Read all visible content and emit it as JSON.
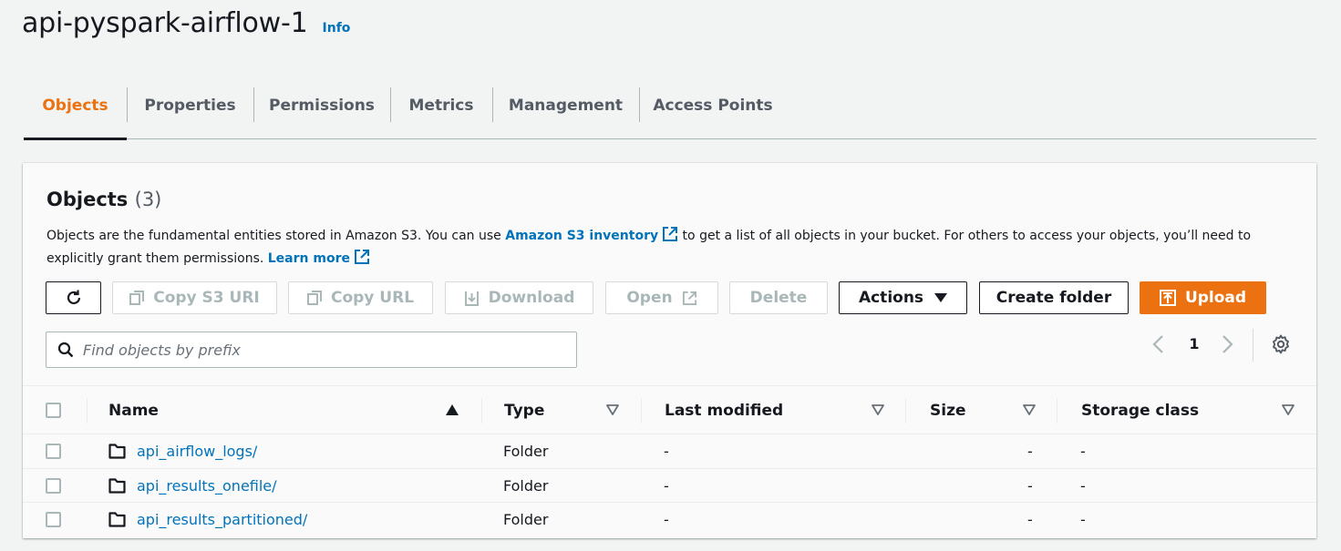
{
  "header": {
    "title": "api-pyspark-airflow-1",
    "info": "Info"
  },
  "tabs": [
    {
      "label": "Objects",
      "active": true
    },
    {
      "label": "Properties",
      "active": false
    },
    {
      "label": "Permissions",
      "active": false
    },
    {
      "label": "Metrics",
      "active": false
    },
    {
      "label": "Management",
      "active": false
    },
    {
      "label": "Access Points",
      "active": false
    }
  ],
  "panel": {
    "title": "Objects",
    "count": "(3)",
    "desc_pre": "Objects are the fundamental entities stored in Amazon S3. You can use ",
    "desc_link": "Amazon S3 inventory",
    "desc_mid": " to get a list of all objects in your bucket. For others to access your objects, you’ll need to explicitly grant them permissions. ",
    "learn_more": "Learn more"
  },
  "toolbar": {
    "copy_uri": "Copy S3 URI",
    "copy_url": "Copy URL",
    "download": "Download",
    "open": "Open",
    "delete": "Delete",
    "actions": "Actions",
    "create_folder": "Create folder",
    "upload": "Upload"
  },
  "search": {
    "placeholder": "Find objects by prefix"
  },
  "pagination": {
    "page": "1"
  },
  "table": {
    "columns": {
      "name": "Name",
      "type": "Type",
      "last_modified": "Last modified",
      "size": "Size",
      "storage_class": "Storage class"
    },
    "rows": [
      {
        "name": "api_airflow_logs/",
        "type": "Folder",
        "last_modified": "-",
        "size": "-",
        "storage_class": "-"
      },
      {
        "name": "api_results_onefile/",
        "type": "Folder",
        "last_modified": "-",
        "size": "-",
        "storage_class": "-"
      },
      {
        "name": "api_results_partitioned/",
        "type": "Folder",
        "last_modified": "-",
        "size": "-",
        "storage_class": "-"
      }
    ]
  },
  "colors": {
    "accent": "#ec7211",
    "link": "#0073bb",
    "text": "#16191f",
    "muted": "#545b64",
    "disabled": "#aab7b8"
  }
}
